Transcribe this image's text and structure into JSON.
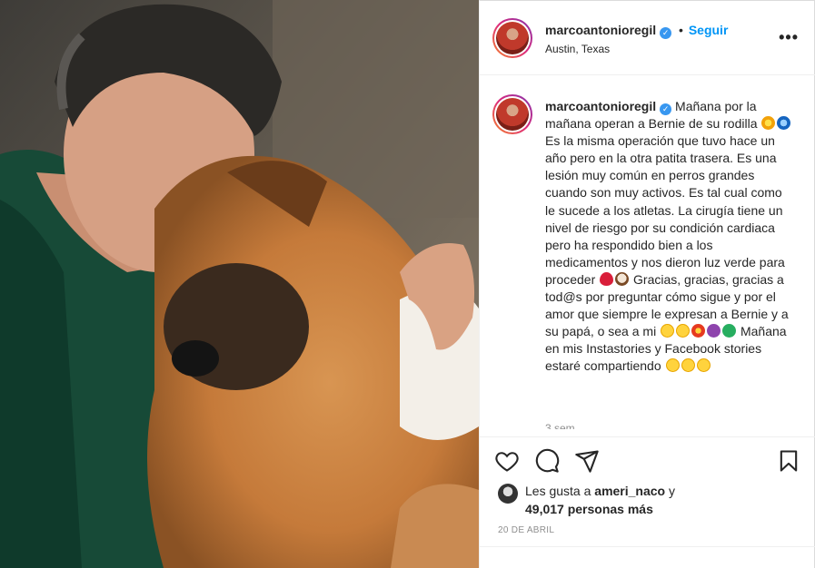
{
  "post": {
    "username": "marcoantonioregil",
    "follow_label": "Seguir",
    "dot": "•",
    "location": "Austin, Texas",
    "more_label": "•••"
  },
  "caption": {
    "username": "marcoantonioregil",
    "part1": "Mañana por la mañana operan a Bernie de su rodilla",
    "part2": "Es la misma operación que tuvo hace un año pero en la otra patita trasera. Es una lesión muy común en perros grandes cuando son muy activos. Es tal cual como le sucede a los atletas. La cirugía tiene un nivel de riesgo por su condición cardiaca pero ha respondido bien a los medicamentos y nos dieron luz verde para proceder",
    "part3": "Gracias, gracias, gracias a tod@s por preguntar cómo sigue y por el amor que siempre le expresan a Bernie y a su papá, o sea a mi",
    "part4": "Mañana en mis Instastories y Facebook stories estaré compartiendo",
    "time_ago": "3 sem"
  },
  "likes": {
    "prefix": "Les gusta a",
    "user": "ameri_naco",
    "connector": "y",
    "count": "49,017 personas más"
  },
  "date": "20 DE ABRIL",
  "icons": {
    "like": "heart-icon",
    "comment": "comment-icon",
    "share": "paper-plane-icon",
    "save": "bookmark-icon",
    "verified": "verified-badge-icon"
  },
  "colors": {
    "link": "#0095f6",
    "verified": "#3897f0",
    "muted": "#8e8e8e"
  }
}
